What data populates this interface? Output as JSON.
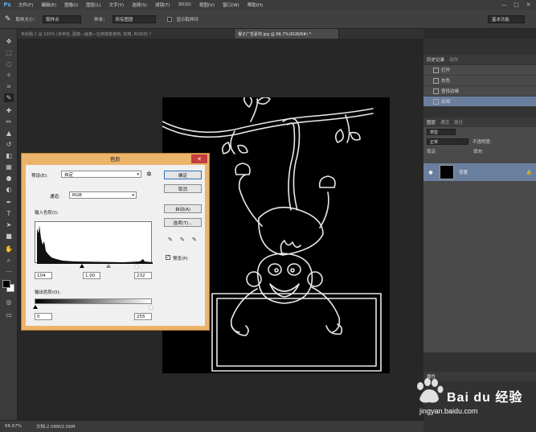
{
  "app": {
    "logo": "Ps"
  },
  "menu": [
    "文件(F)",
    "编辑(E)",
    "图像(I)",
    "图层(L)",
    "文字(Y)",
    "选择(S)",
    "滤镜(T)",
    "3D(D)",
    "视图(V)",
    "窗口(W)",
    "帮助(H)"
  ],
  "window_controls": [
    "—",
    "□",
    "✕"
  ],
  "options_bar": {
    "sample_size_label": "取样大小：",
    "sample_size_value": "取样点",
    "sample_label": "样本：",
    "sample_value": "所有图层",
    "show_ring_label": "显示取样环",
    "workspace": "基本功能"
  },
  "tabs": [
    {
      "label": "未标题-1 @ 100% (未命名, 图像—画像—应用或者使用, 玫瑰, RGB/8) *"
    },
    {
      "label": "猴子广告素材.jpg @ 66.7%(RGB/8#) *"
    }
  ],
  "dialog": {
    "title": "色阶",
    "close": "✕",
    "preset_label": "预设(E):",
    "preset_value": "自定",
    "channel_label": "通道:",
    "channel_value": "RGB",
    "input_levels_label": "输入色阶(I):",
    "input_black": "104",
    "input_mid": "1.00",
    "input_white": "232",
    "output_levels_label": "输出色阶(O):",
    "output_black": "0",
    "output_white": "255",
    "ok": "确定",
    "cancel": "取消",
    "auto": "自动(A)",
    "options": "选项(T)...",
    "preview": "预览(P)",
    "preview_checked": true
  },
  "panels": {
    "history_tabs": [
      "历史记录",
      "动作"
    ],
    "history_items": [
      {
        "label": "打开",
        "active": false
      },
      {
        "label": "去色",
        "active": false
      },
      {
        "label": "查找边缘",
        "active": false
      },
      {
        "label": "反相",
        "active": true
      }
    ],
    "layers_tabs": [
      "图层",
      "通道",
      "路径"
    ],
    "kind_label": "类型",
    "blend_mode": "正常",
    "opacity_label": "不透明度:",
    "lock_label": "锁定:",
    "fill_label": "填充:",
    "layer_name": "背景",
    "properties_tab": "属性"
  },
  "status": {
    "zoom": "66.67%",
    "doc": "文档:2.06M/2.06M"
  },
  "watermark": {
    "brand": "Bai du 经验",
    "url": "jingyan.baidu.com"
  }
}
